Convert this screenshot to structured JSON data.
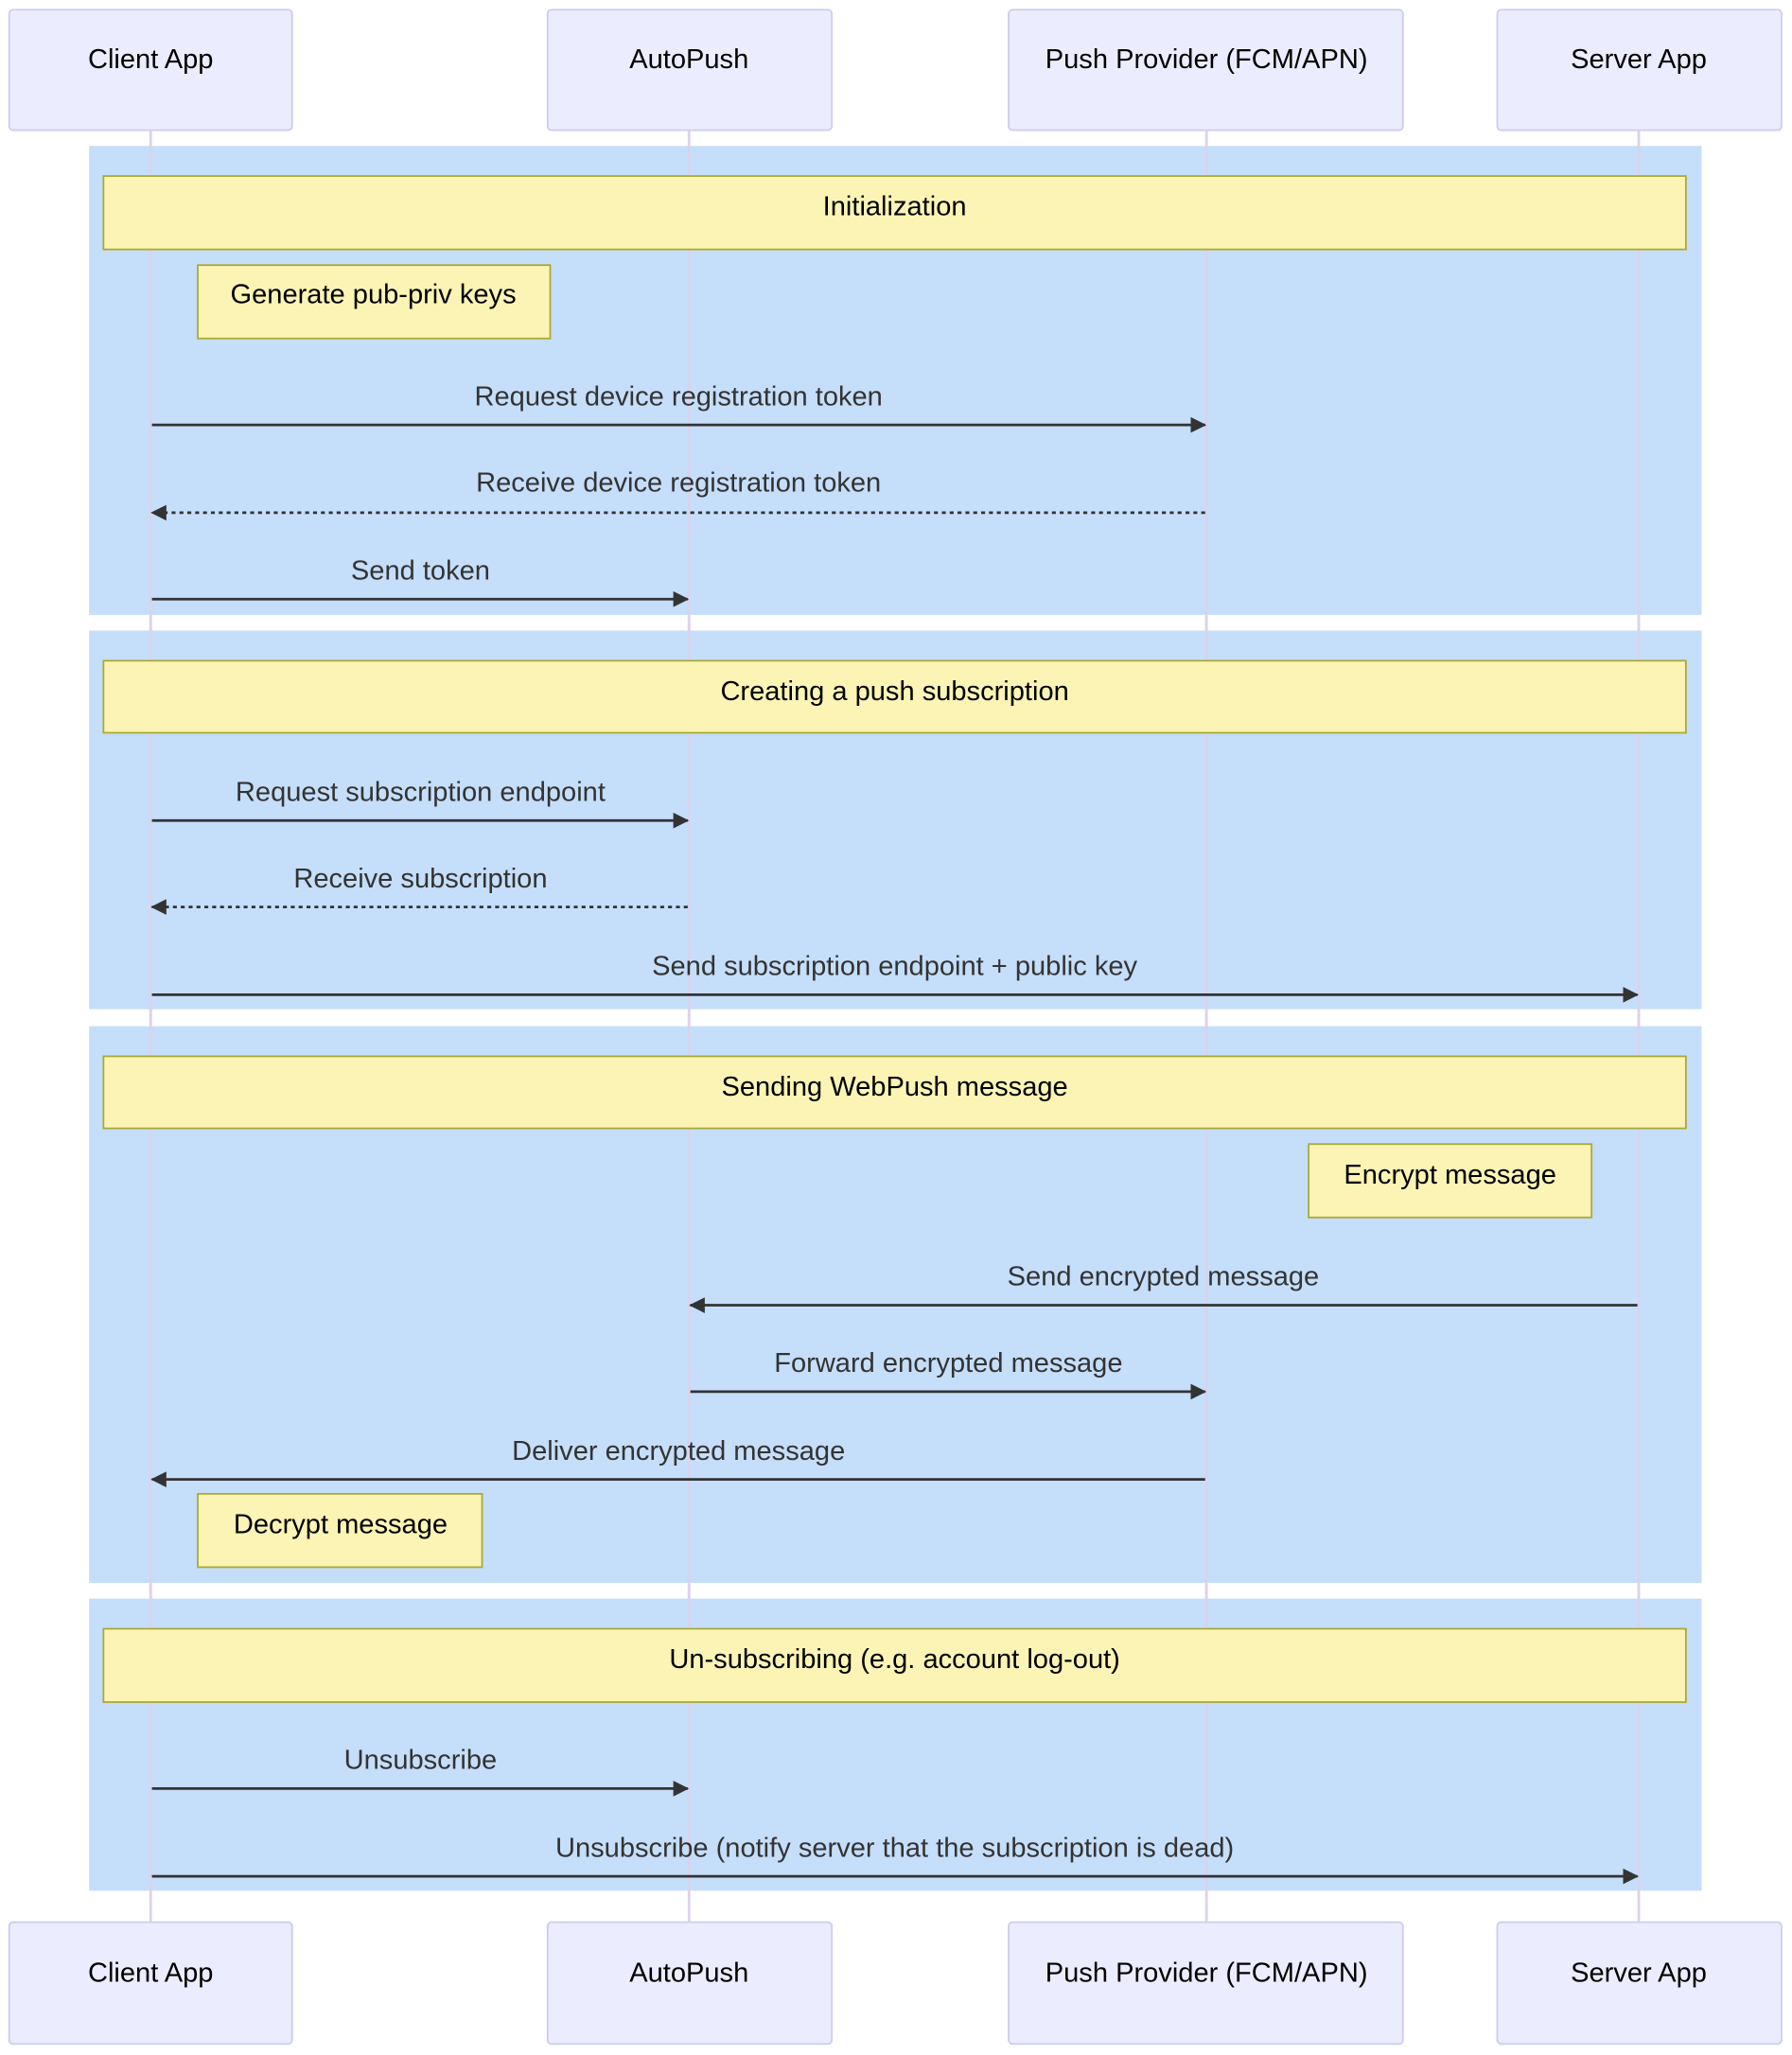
{
  "diagram": {
    "type": "sequence",
    "colors": {
      "actor_fill": "#ECECFF",
      "actor_border": "#CCCCEE",
      "section_fill": "#C5DEFA",
      "note_fill": "#FCF4B5",
      "note_border": "#AAAA33",
      "message_color": "#333333"
    },
    "actors": [
      {
        "id": "client",
        "label": "Client App"
      },
      {
        "id": "autopush",
        "label": "AutoPush"
      },
      {
        "id": "provider",
        "label": "Push Provider (FCM/APN)"
      },
      {
        "id": "server",
        "label": "Server App"
      }
    ],
    "sections": [
      {
        "title": "Initialization",
        "steps": [
          {
            "kind": "note",
            "over": "client",
            "text": "Generate pub-priv keys"
          },
          {
            "kind": "message",
            "from": "client",
            "to": "provider",
            "style": "solid",
            "text": "Request device registration token"
          },
          {
            "kind": "message",
            "from": "provider",
            "to": "client",
            "style": "dotted",
            "text": "Receive device registration token"
          },
          {
            "kind": "message",
            "from": "client",
            "to": "autopush",
            "style": "solid",
            "text": "Send token"
          }
        ]
      },
      {
        "title": "Creating a push subscription",
        "steps": [
          {
            "kind": "message",
            "from": "client",
            "to": "autopush",
            "style": "solid",
            "text": "Request subscription endpoint"
          },
          {
            "kind": "message",
            "from": "autopush",
            "to": "client",
            "style": "dotted",
            "text": "Receive subscription"
          },
          {
            "kind": "message",
            "from": "client",
            "to": "server",
            "style": "solid",
            "text": "Send subscription endpoint + public key"
          }
        ]
      },
      {
        "title": "Sending WebPush message",
        "steps": [
          {
            "kind": "note",
            "over": "server",
            "text": "Encrypt message"
          },
          {
            "kind": "message",
            "from": "server",
            "to": "autopush",
            "style": "solid",
            "text": "Send encrypted message"
          },
          {
            "kind": "message",
            "from": "autopush",
            "to": "provider",
            "style": "solid",
            "text": "Forward encrypted message"
          },
          {
            "kind": "message",
            "from": "provider",
            "to": "client",
            "style": "solid",
            "text": "Deliver encrypted message"
          },
          {
            "kind": "note",
            "over": "client",
            "text": "Decrypt message"
          }
        ]
      },
      {
        "title": "Un-subscribing (e.g. account log-out)",
        "steps": [
          {
            "kind": "message",
            "from": "client",
            "to": "autopush",
            "style": "solid",
            "text": "Unsubscribe"
          },
          {
            "kind": "message",
            "from": "client",
            "to": "server",
            "style": "solid",
            "text": "Unsubscribe (notify server that the subscription is dead)"
          }
        ]
      }
    ]
  }
}
